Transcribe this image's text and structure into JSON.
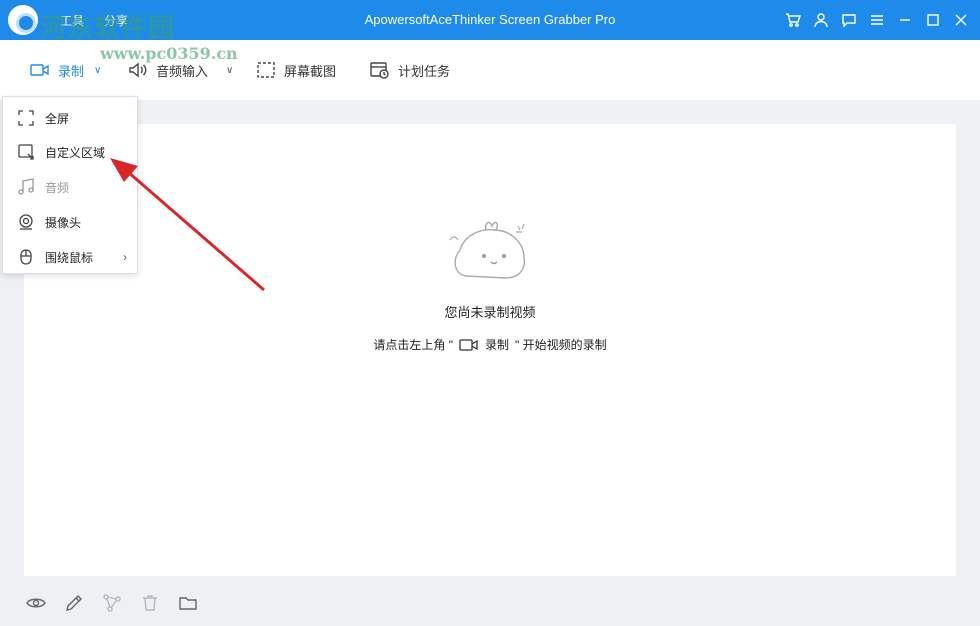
{
  "app": {
    "title": "ApowersoftAceThinker Screen Grabber Pro"
  },
  "menubar": {
    "tools": "工具",
    "share": "分享"
  },
  "watermark": {
    "text": "河东软件园",
    "url": "www.pc0359.cn"
  },
  "toolbar": {
    "record": "录制",
    "audio_input": "音频输入",
    "screenshot": "屏幕截图",
    "schedule": "计划任务"
  },
  "dropdown": {
    "items": [
      {
        "label": "全屏",
        "icon": "fullscreen-icon"
      },
      {
        "label": "自定义区域",
        "icon": "custom-region-icon"
      },
      {
        "label": "音频",
        "icon": "music-note-icon"
      },
      {
        "label": "摄像头",
        "icon": "webcam-icon"
      },
      {
        "label": "围绕鼠标",
        "icon": "mouse-icon"
      }
    ]
  },
  "main": {
    "empty_title": "您尚未录制视频",
    "hint_prefix": "请点击左上角 \"",
    "hint_record": "录制",
    "hint_suffix": "\" 开始视频的录制"
  },
  "colors": {
    "accent": "#1e8bea",
    "annotation_arrow": "#d9262b"
  }
}
